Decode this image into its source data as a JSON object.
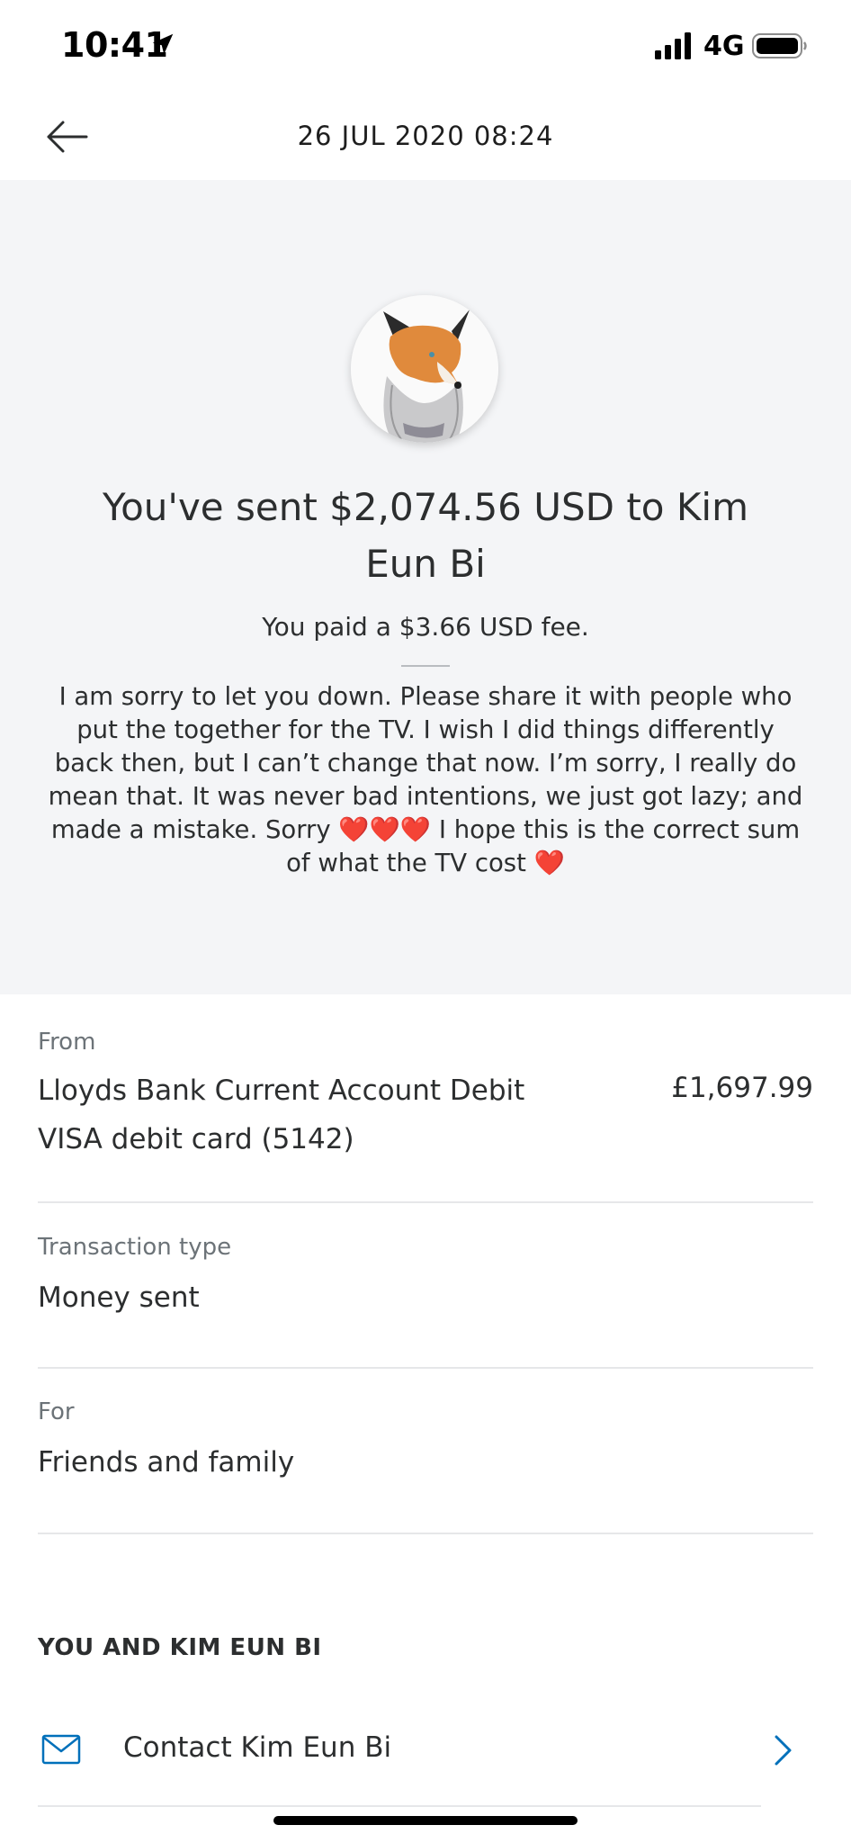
{
  "status_bar": {
    "time": "10:41",
    "network": "4G",
    "icons": [
      "location-arrow-icon",
      "signal-bars-icon",
      "battery-icon"
    ]
  },
  "header": {
    "title": "26 JUL 2020  08:24",
    "back_icon": "arrow-left-icon"
  },
  "hero": {
    "avatar_icon": "fox-avatar",
    "headline": "You've sent $2,074.56 USD to Kim Eun Bi",
    "fee": "You paid a $3.66 USD fee.",
    "note": "I am sorry to let you down.  Please share it with people who put the together for the TV.  I wish I did things differently back then, but I can’t change that now.  I’m sorry, I really do mean that.  It was never bad intentions, we just got lazy; and made a mistake.  Sorry ❤️❤️❤️ I hope this is the correct sum of what the TV cost ❤️"
  },
  "details": {
    "from": {
      "label": "From",
      "value": "Lloyds Bank Current Account Debit VISA debit card (5142)",
      "amount": "£1,697.99"
    },
    "transaction_type": {
      "label": "Transaction type",
      "value": "Money sent"
    },
    "for": {
      "label": "For",
      "value": "Friends and family"
    }
  },
  "contact_section": {
    "title": "YOU AND KIM EUN BI",
    "contact_label": "Contact Kim Eun Bi",
    "mail_icon": "mail-icon",
    "chevron_icon": "chevron-right-icon"
  },
  "colors": {
    "hero_background": "#f4f5f7",
    "accent_blue": "#0070ba",
    "text_primary": "#2c2e2f",
    "text_secondary": "#6c7378"
  }
}
